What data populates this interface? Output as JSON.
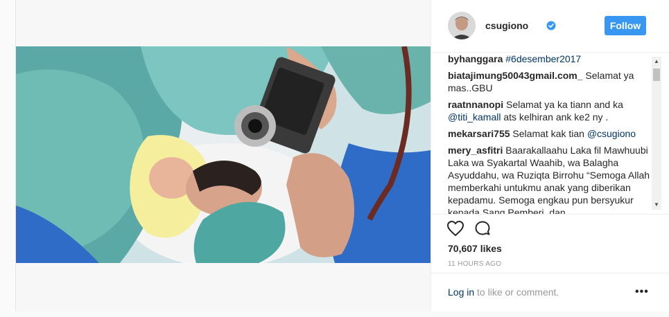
{
  "post": {
    "username": "csugiono",
    "follow_label": "Follow",
    "likes": "70,607 likes",
    "time": "11 HOURS AGO",
    "login_link": "Log in",
    "login_rest": " to like or comment.",
    "more_label": "•••"
  },
  "comments": [
    {
      "user": "byhanggara",
      "text": "",
      "link": "#6desember2017",
      "after": ""
    },
    {
      "user": "biatajimung50043gmail.com_",
      "text": " Selamat ya mas..GBU",
      "link": "",
      "after": ""
    },
    {
      "user": "raatnnanopi",
      "text": " Selamat ya ka tiann and ka ",
      "link": "@titi_kamall",
      "after": " ats kelhiran ank ke2 ny ."
    },
    {
      "user": "mekarsari755",
      "text": " Selamat kak tian ",
      "link": "@csugiono",
      "after": ""
    },
    {
      "user": "mery_asfitri",
      "text": " Baarakallaahu Laka fil Mawhuubi Laka wa Syakartal Waahib, wa Balagha Asyuddahu, wa Ruziqta Birrohu “Semoga Allah memberkahi untukmu anak yang diberikan kepadamu. Semoga engkau pun bersyukur kepada Sang Pemberi, dan",
      "link": "",
      "after": ""
    }
  ],
  "colors": {
    "accent": "#3897f0",
    "link": "#003569",
    "verified": "#3897f0",
    "muted": "#999999"
  },
  "icons": {
    "like": "heart-icon",
    "comment": "comment-bubble-icon",
    "verified": "verified-badge-icon",
    "more": "more-options-icon"
  }
}
